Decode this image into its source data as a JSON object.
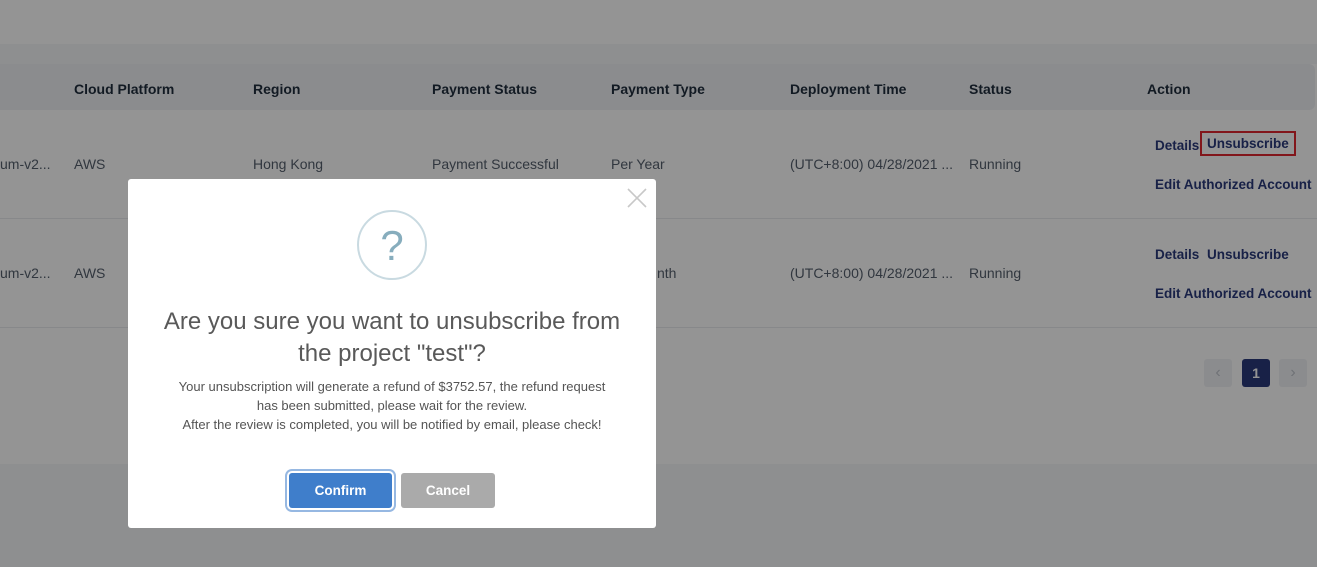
{
  "table": {
    "headers": {
      "cloud_platform": "Cloud Platform",
      "region": "Region",
      "payment_status": "Payment Status",
      "payment_type": "Payment Type",
      "deployment_time": "Deployment Time",
      "status": "Status",
      "action": "Action"
    },
    "rows": [
      {
        "name": "um-v2...",
        "cloud_platform": "AWS",
        "region": "Hong Kong",
        "payment_status": "Payment Successful",
        "payment_type": "Per Year",
        "deployment_time": "(UTC+8:00) 04/28/2021 ...",
        "status": "Running",
        "actions": {
          "details": "Details",
          "unsubscribe": "Unsubscribe",
          "edit": "Edit Authorized Account"
        }
      },
      {
        "name": "um-v2...",
        "cloud_platform": "AWS",
        "payment_type": "nth",
        "deployment_time": "(UTC+8:00) 04/28/2021 ...",
        "status": "Running",
        "actions": {
          "details": "Details",
          "unsubscribe": "Unsubscribe",
          "edit": "Edit Authorized Account"
        }
      }
    ]
  },
  "pagination": {
    "prev": "‹",
    "current": "1",
    "next": "›"
  },
  "modal": {
    "icon": "?",
    "title": "Are you sure you want to unsubscribe from the project \"test\"?",
    "body_line1": "Your unsubscription will generate a refund of $3752.57, the refund request has been submitted, please wait for the review.",
    "body_line2": "After the review is completed, you will be notified by email, please check!",
    "confirm_label": "Confirm",
    "cancel_label": "Cancel"
  },
  "colors": {
    "accent": "#3f7ecb",
    "link": "#2a3a7b",
    "highlight": "#e0262f",
    "cancel": "#aaaaaa"
  }
}
